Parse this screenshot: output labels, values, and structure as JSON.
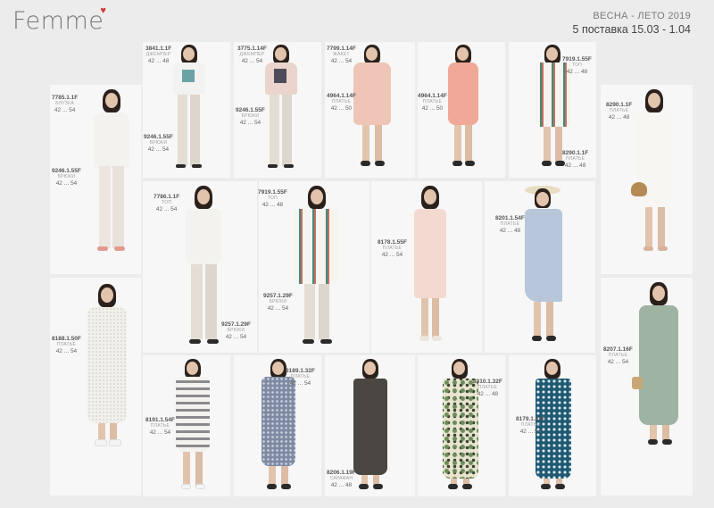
{
  "brand": {
    "logo": "Femmе"
  },
  "header": {
    "season": "ВЕСНА - ЛЕТО 2019",
    "delivery": "5 поставка 15.03 - 1.04"
  },
  "labels": [
    {
      "id": "l1",
      "code": "7785.1.1F",
      "type": "БЛУЗКА",
      "size": "42 ... 54"
    },
    {
      "id": "l2",
      "code": "9246.1.55F",
      "type": "БРЮКИ",
      "size": "42 ... 54"
    },
    {
      "id": "l3",
      "code": "3841.1.1F",
      "type": "ДЖЕМПЕР",
      "size": "42 ... 48"
    },
    {
      "id": "l4",
      "code": "9246.1.55F",
      "type": "БРЮКИ",
      "size": "42 ... 54"
    },
    {
      "id": "l5",
      "code": "3775.1.14F",
      "type": "ДЖЕМПЕР",
      "size": "42 ... 54"
    },
    {
      "id": "l6",
      "code": "9246.1.55F",
      "type": "БРЮКИ",
      "size": "42 ... 54"
    },
    {
      "id": "l7",
      "code": "7799.1.14F",
      "type": "ЖАКЕТ",
      "size": "42 ... 54"
    },
    {
      "id": "l8",
      "code": "4964.1.14F",
      "type": "ПЛАТЬЕ",
      "size": "42 ... 50"
    },
    {
      "id": "l9",
      "code": "4964.1.14F",
      "type": "ПЛАТЬЕ",
      "size": "42 ... 50"
    },
    {
      "id": "l10",
      "code": "7919.1.55F",
      "type": "ТОП",
      "size": "42 ... 48"
    },
    {
      "id": "l11",
      "code": "8290.1.1F",
      "type": "ПЛАТЬЕ",
      "size": "42 ... 48"
    },
    {
      "id": "l12",
      "code": "8290.1.1F",
      "type": "ПЛАТЬЕ",
      "size": "42 ... 48"
    },
    {
      "id": "l13",
      "code": "7786.1.1F",
      "type": "ТОП",
      "size": "42 ... 54"
    },
    {
      "id": "l14",
      "code": "9257.1.29F",
      "type": "БРЮКИ",
      "size": "42 ... 54"
    },
    {
      "id": "l15",
      "code": "7919.1.55F",
      "type": "ТОП",
      "size": "42 ... 48"
    },
    {
      "id": "l16",
      "code": "9257.1.29F",
      "type": "БРЮКИ",
      "size": "42 ... 54"
    },
    {
      "id": "l17",
      "code": "8178.1.55F",
      "type": "ПЛАТЬЕ",
      "size": "42 ... 54"
    },
    {
      "id": "l18",
      "code": "8201.1.54F",
      "type": "ПЛАТЬЕ",
      "size": "42 ... 48"
    },
    {
      "id": "l19",
      "code": "8188.1.50F",
      "type": "ПЛАТЬЕ",
      "size": "42 ... 54"
    },
    {
      "id": "l20",
      "code": "8207.1.16F",
      "type": "ПЛАТЬЕ",
      "size": "42 ... 54"
    },
    {
      "id": "l21",
      "code": "8191.1.54F",
      "type": "ПЛАТЬЕ",
      "size": "42 ... 54"
    },
    {
      "id": "l22",
      "code": "8189.1.32F",
      "type": "ПЛАТЬЕ",
      "size": "42 ... 54"
    },
    {
      "id": "l23",
      "code": "8206.1.19F",
      "type": "САРАФАН",
      "size": "42 ... 48"
    },
    {
      "id": "l24",
      "code": "8310.1.32F",
      "type": "ПЛАТЬЕ",
      "size": "42 ... 48"
    },
    {
      "id": "l25",
      "code": "8179.1.32F",
      "type": "ПЛАТЬЕ",
      "size": "42 ... 54"
    }
  ]
}
